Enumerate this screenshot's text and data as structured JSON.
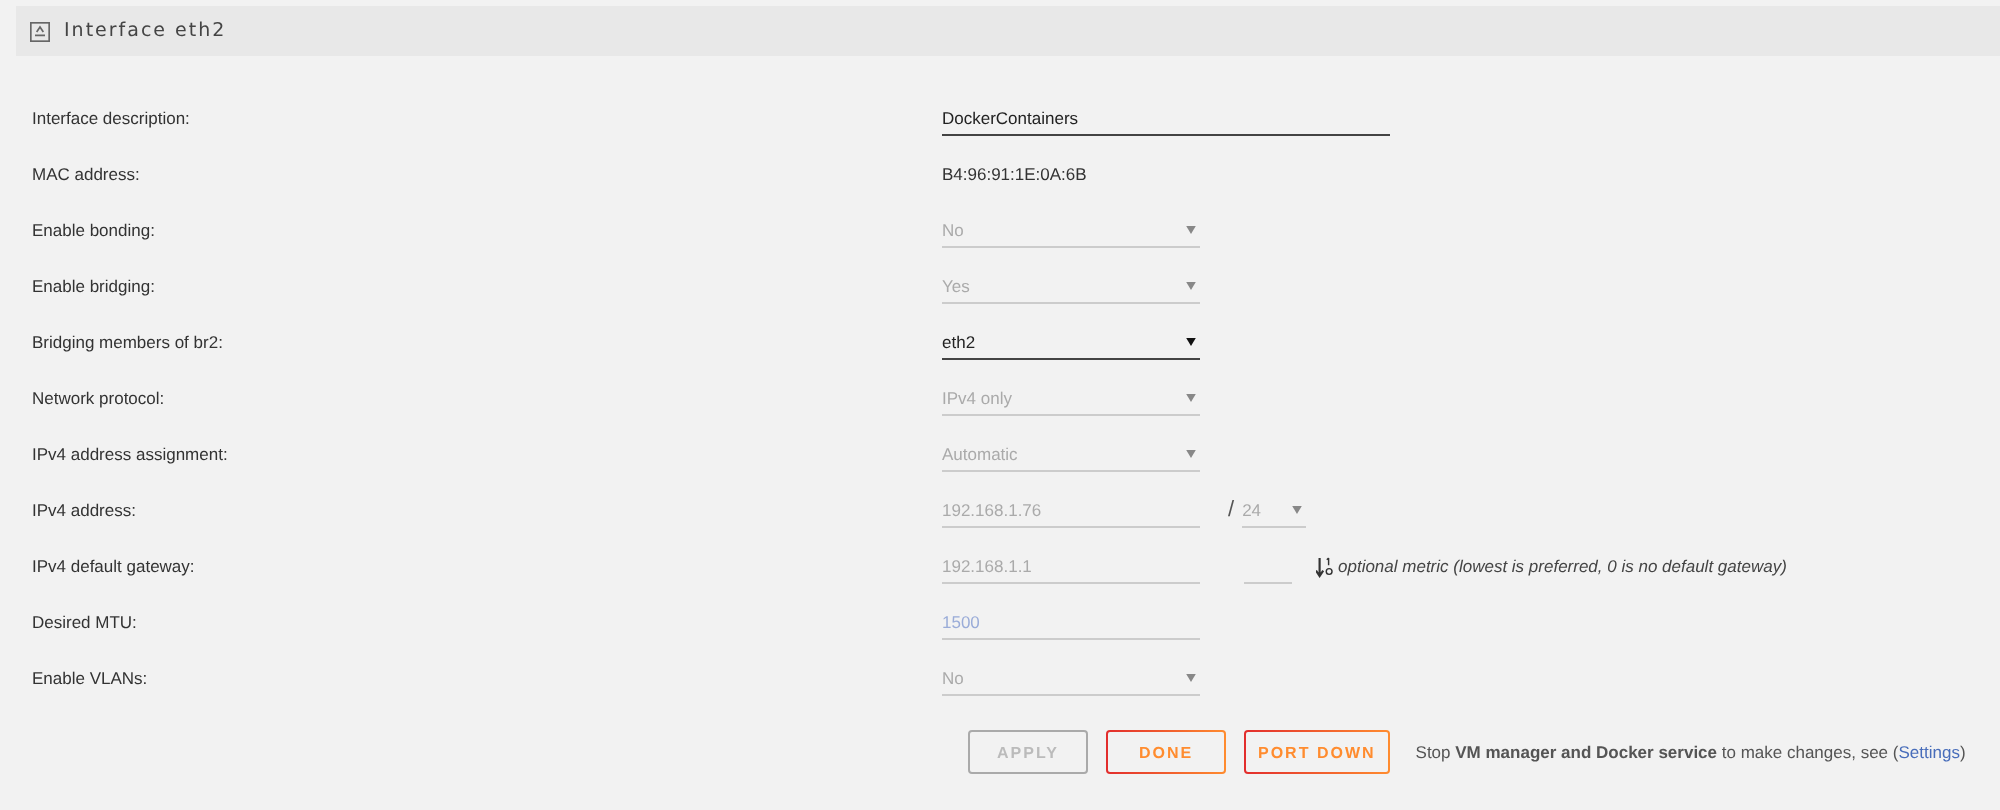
{
  "panel": {
    "title": "Interface eth2"
  },
  "rows": [
    {
      "label": "Interface description:",
      "kind": "input",
      "value": "DockerContainers",
      "disabled": false,
      "wide": true
    },
    {
      "label": "MAC address:",
      "kind": "plain",
      "value": "B4:96:91:1E:0A:6B"
    },
    {
      "label": "Enable bonding:",
      "kind": "select",
      "value": "No",
      "disabled": true
    },
    {
      "label": "Enable bridging:",
      "kind": "select",
      "value": "Yes",
      "disabled": true
    },
    {
      "label": "Bridging members of br2:",
      "kind": "select",
      "value": "eth2",
      "disabled": false
    },
    {
      "label": "Network protocol:",
      "kind": "select",
      "value": "IPv4 only",
      "disabled": true
    },
    {
      "label": "IPv4 address assignment:",
      "kind": "select",
      "value": "Automatic",
      "disabled": true
    },
    {
      "label": "IPv4 address:",
      "kind": "ip",
      "value": "192.168.1.76",
      "disabled": true,
      "separator": "/",
      "prefix": "24"
    },
    {
      "label": "IPv4 default gateway:",
      "kind": "gateway",
      "value": "192.168.1.1",
      "disabled": true,
      "hint": "optional metric (lowest is preferred, 0 is no default gateway)"
    },
    {
      "label": "Desired MTU:",
      "kind": "number",
      "value": "1500",
      "disabled": true
    },
    {
      "label": "Enable VLANs:",
      "kind": "select",
      "value": "No",
      "disabled": true
    }
  ],
  "buttons": [
    {
      "label": "APPLY",
      "disabled": true
    },
    {
      "label": "DONE",
      "disabled": false
    },
    {
      "label": "PORT DOWN",
      "disabled": false
    }
  ],
  "note": {
    "before": "Stop **VM manager and Docker service** to make changes, see (",
    "link": "Settings",
    "after": ")"
  }
}
